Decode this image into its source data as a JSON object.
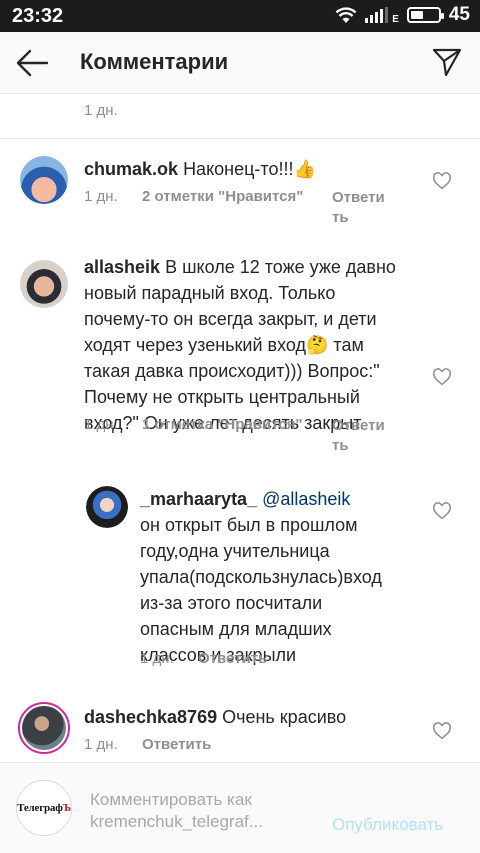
{
  "status_bar": {
    "time": "23:32",
    "network_type": "E",
    "battery": "45",
    "battery_level": 0.45
  },
  "header": {
    "title": "Комментарии",
    "back_icon": "arrow-left-icon",
    "share_icon": "send-icon"
  },
  "top_meta": {
    "time": "1 дн."
  },
  "comments": [
    {
      "username": "chumak.ok",
      "text": "Наконец-то!!!👍",
      "time": "1 дн.",
      "likes": "2 отметки \"Нравится\"",
      "reply_line1": "Ответи",
      "reply_line2": "ть"
    },
    {
      "username": "allasheik",
      "text_line1": " В школе 12 тоже уже давно",
      "text_line2": "новый парадный вход. Только",
      "text_line3": "почему-то он всегда закрыт, и дети",
      "text_line4": "ходят через узенький вход🤔 там",
      "text_line5": "такая давка происходит))) Вопрос:\"",
      "text_line6": "Почему не открыть центральный",
      "text_line7": "вход?\" Он уже лет десять закрыт.",
      "time": "1 дн.",
      "likes": "1 отметка \"Нравится\"",
      "reply_line1": "Ответи",
      "reply_line2": "ть"
    },
    {
      "username": "_marhaaryta_",
      "mention": "@allasheik",
      "text_line1": "он открыт был в прошлом",
      "text_line2": "году,одна учительница",
      "text_line3": "упала(подскользнулась)вход",
      "text_line4": "из-за этого посчитали",
      "text_line5": "опасным для младших",
      "text_line6": "классов и закрыли",
      "time": "1 дн.",
      "reply": "Ответить"
    },
    {
      "username": "dashechka8769",
      "text": " Очень красиво",
      "time": "1 дн.",
      "reply": "Ответить"
    }
  ],
  "composer": {
    "avatar_logo_black": "Телеграф",
    "avatar_logo_red": "Ъ",
    "placeholder": "Комментировать как kremenchuk_telegraf...",
    "line1": "Комментировать как",
    "line2": "kremenchuk_telegraf...",
    "publish": "Опубликовать"
  },
  "colors": {
    "muted": "#8e8e8e",
    "link": "#003569",
    "publish_disabled": "#b2dffc",
    "status_bar": "#1c1c1c"
  }
}
